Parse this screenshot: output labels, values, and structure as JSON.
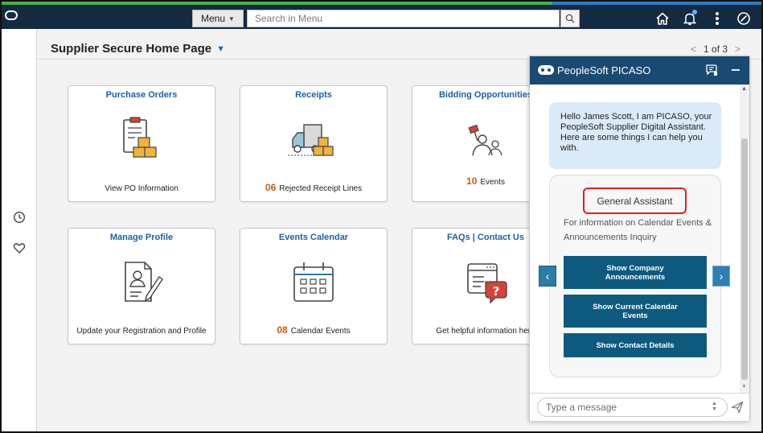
{
  "topbar": {
    "menu_label": "Menu",
    "search_placeholder": "Search in Menu"
  },
  "header": {
    "title": "Supplier Secure Home Page",
    "pager": "1 of 3"
  },
  "tiles": [
    {
      "title": "Purchase Orders",
      "icon": "clipboard-boxes-icon",
      "footer_count": "",
      "footer_text": "View PO Information"
    },
    {
      "title": "Receipts",
      "icon": "delivery-truck-icon",
      "footer_count": "06",
      "footer_text": "Rejected Receipt Lines"
    },
    {
      "title": "Bidding Opportunities",
      "icon": "bidding-icon",
      "footer_count": "10",
      "footer_text": "Events"
    },
    {
      "title": "Manage Profile",
      "icon": "profile-edit-icon",
      "footer_count": "",
      "footer_text": "Update your Registration and Profile"
    },
    {
      "title": "Events Calendar",
      "icon": "calendar-icon",
      "footer_count": "08",
      "footer_text": "Calendar Events"
    },
    {
      "title": "FAQs | Contact Us",
      "icon": "faq-chat-icon",
      "footer_count": "",
      "footer_text": "Get helpful information here"
    }
  ],
  "chat": {
    "title": "PeopleSoft PICASO",
    "greeting": "Hello James Scott, I am PICASO, your PeopleSoft Supplier Digital Assistant. Here are some things I can help you with.",
    "card_title": "General Assistant",
    "card_info": "For information on Calendar Events & Announcements Inquiry",
    "buttons": [
      "Show Company Announcements",
      "Show Current Calendar Events",
      "Show Contact Details"
    ],
    "input_placeholder": "Type a message"
  },
  "colors": {
    "topbar": "#142a40",
    "link_blue": "#1f5fa8",
    "count_orange": "#c65b15",
    "chat_header": "#1a4a72",
    "action_button": "#0e5a7f",
    "highlight_red": "#e0211f"
  }
}
